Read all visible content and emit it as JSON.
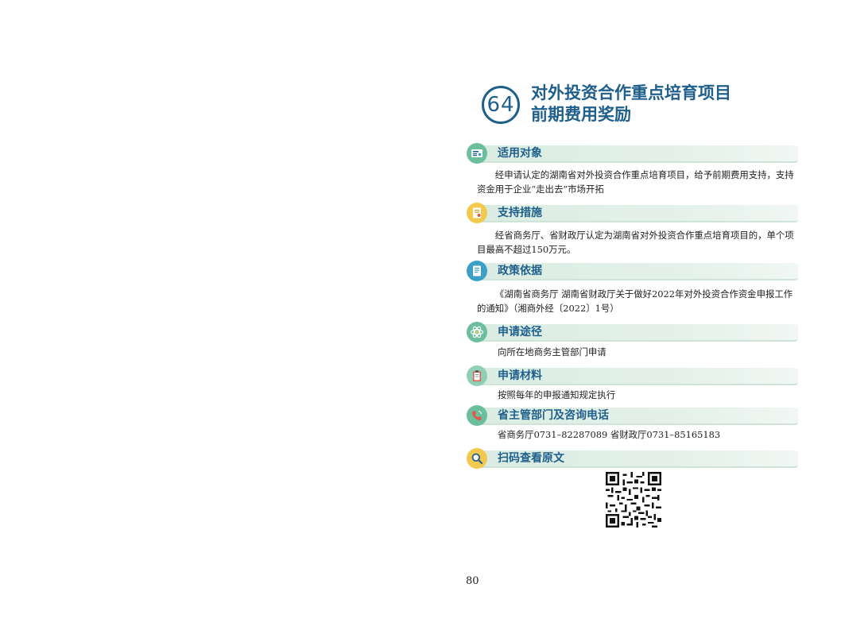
{
  "header": {
    "number": "64",
    "title_line1": "对外投资合作重点培育项目",
    "title_line2": "前期费用奖励"
  },
  "sections": [
    {
      "title": "适用对象",
      "icon": "id-card-icon",
      "color": "#6bbf9d",
      "body": "经申请认定的湖南省对外投资合作重点培育项目，给予前期费用支持，支持资金用于企业“走出去”市场开拓"
    },
    {
      "title": "支持措施",
      "icon": "certificate-icon",
      "color": "#f2c94c",
      "body": "经省商务厅、省财政厅认定为湖南省对外投资合作重点培育项目的，单个项目最高不超过150万元。"
    },
    {
      "title": "政策依据",
      "icon": "document-icon",
      "color": "#3aa0c8",
      "body": "《湖南省商务厅 湖南省财政厅关于做好2022年对外投资合作资金申报工作的通知》（湘商外经〔2022〕1号）"
    },
    {
      "title": "申请途径",
      "icon": "atom-icon",
      "color": "#6bbf9d",
      "body": "向所在地商务主管部门申请"
    },
    {
      "title": "申请材料",
      "icon": "clipboard-icon",
      "color": "#8fd0b4",
      "body": "按照每年的申报通知规定执行"
    },
    {
      "title": "省主管部门及咨询电话",
      "icon": "phone-icon",
      "color": "#6bbf9d",
      "body": "省商务厅0731–82287089  省财政厅0731–85165183"
    },
    {
      "title": "扫码查看原文",
      "icon": "search-icon",
      "color": "#f2c94c",
      "body": ""
    }
  ],
  "qr_code": {
    "icon": "qr-code-icon"
  },
  "footer": {
    "page_number": "80"
  }
}
